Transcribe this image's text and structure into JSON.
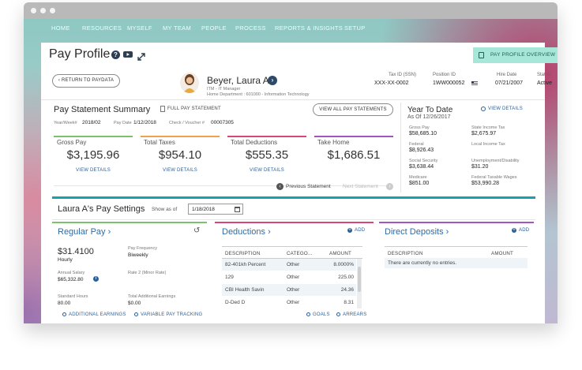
{
  "nav": {
    "items": [
      "HOME",
      "RESOURCES",
      "MYSELF",
      "MY TEAM",
      "PEOPLE",
      "PROCESS",
      "REPORTS & INSIGHTS",
      "SETUP"
    ]
  },
  "page": {
    "title": "Pay Profile",
    "toast": "PAY PROFILE OVERVIEW",
    "return_button": "‹ RETURN TO PAYDATA"
  },
  "employee": {
    "name": "Beyer, Laura A",
    "role": "ITM - IT Manager",
    "department": "Home Department : 601000 - Information Technology",
    "tax_id_label": "Tax ID (SSN)",
    "tax_id": "XXX-XX-0002",
    "position_id_label": "Position ID",
    "position_id": "1WW000052",
    "hire_date_label": "Hire Date",
    "hire_date": "07/21/2007",
    "status_label": "Status",
    "status": "Active"
  },
  "pay_statement": {
    "title": "Pay Statement Summary",
    "full_link": "FULL PAY STATEMENT",
    "view_all": "VIEW ALL PAY STATEMENTS",
    "year_week_label": "Year/Week#",
    "year_week": "2018/02",
    "pay_date_label": "Pay Date",
    "pay_date": "1/12/2018",
    "check_label": "Check / Voucher #",
    "check": "00007305",
    "cards": [
      {
        "label": "Gross Pay",
        "amount": "$3,195.96",
        "link": "VIEW DETAILS",
        "color": "#7cc26a"
      },
      {
        "label": "Total Taxes",
        "amount": "$954.10",
        "link": "VIEW DETAILS",
        "color": "#f0a24a"
      },
      {
        "label": "Total Deductions",
        "amount": "$555.35",
        "link": "VIEW DETAILS",
        "color": "#d8457a"
      },
      {
        "label": "Take Home",
        "amount": "$1,686.51",
        "link": "",
        "color": "#a552c4"
      }
    ],
    "prev": "Previous Statement",
    "next": "Next Statement"
  },
  "ytd": {
    "title": "Year To Date",
    "as_of": "As Of 12/26/2017",
    "view_details": "VIEW DETAILS",
    "items": [
      {
        "label": "Gross Pay",
        "value": "$58,685.10"
      },
      {
        "label": "State Income Tax",
        "value": "$2,675.97"
      },
      {
        "label": "Federal",
        "value": "$8,926.43"
      },
      {
        "label": "Local Income Tax",
        "value": ""
      },
      {
        "label": "Social Security",
        "value": "$3,638.44"
      },
      {
        "label": "Unemployment/Disability",
        "value": "$31.20"
      },
      {
        "label": "Medicare",
        "value": "$851.00"
      },
      {
        "label": "Federal Taxable Wages",
        "value": "$53,990.28"
      }
    ]
  },
  "pay_settings": {
    "title": "Laura A's Pay Settings",
    "show_as_of_label": "Show as of",
    "date": "1/18/2018"
  },
  "regular_pay": {
    "title": "Regular Pay ›",
    "rate": "$31.4100",
    "rate_unit": "Hourly",
    "frequency_label": "Pay Frequency",
    "frequency": "Biweekly",
    "annual_label": "Annual Salary",
    "annual": "$65,332.80",
    "rate2_label": "Rate 2 (Minor Rate)",
    "hours_label": "Standard Hours",
    "hours": "80.00",
    "additional_label": "Total Additional Earnings",
    "additional": "$0.00",
    "link1": "ADDITIONAL EARNINGS",
    "link2": "VARIABLE PAY TRACKING"
  },
  "deductions": {
    "title": "Deductions ›",
    "add": "ADD",
    "headers": [
      "DESCRIPTION",
      "CATEGO...",
      "AMOUNT"
    ],
    "rows": [
      [
        "82-401kh Percent",
        "Other",
        "8.0000%"
      ],
      [
        "129",
        "Other",
        "225.00"
      ],
      [
        "CBI Health Savin",
        "Other",
        "24.36"
      ],
      [
        "D-Ded D",
        "Other",
        "8.31"
      ]
    ],
    "goals": "GOALS",
    "arrears": "ARREARS"
  },
  "direct_deposits": {
    "title": "Direct Deposits ›",
    "add": "ADD",
    "headers": [
      "DESCRIPTION",
      "AMOUNT"
    ],
    "empty": "There are currently no entries."
  }
}
